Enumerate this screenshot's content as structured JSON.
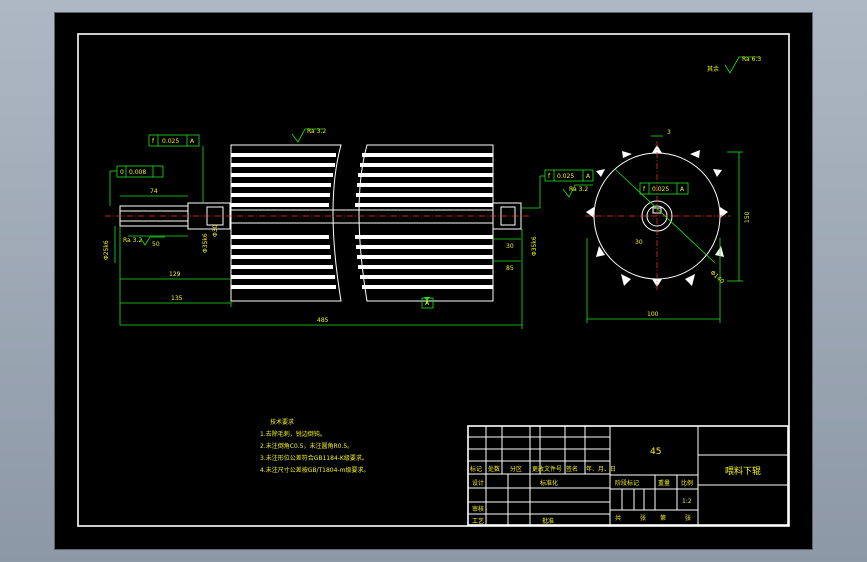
{
  "roughness_note": {
    "prefix": "其余",
    "value": "Ra 6.3"
  },
  "side_view": {
    "tolerance_labels": [
      "f",
      "0.025",
      "A"
    ],
    "tolerance_circ": [
      "f",
      "0.025",
      "A"
    ],
    "roughness": "Ra 3.2",
    "dim_top": "3",
    "dim_diam_large": "Φ140",
    "dim_small": "30",
    "dim_height": "150",
    "dim_width": "100"
  },
  "main_view": {
    "roughness_top": "Ra 3.2",
    "roughness_left": "Ra 3.2",
    "roughness_right": "Ra 3.2",
    "tol_left_top": [
      "f",
      "0.025",
      "A"
    ],
    "tol_left_mid": [
      "0",
      "0.008",
      ""
    ],
    "tol_right": [
      "f",
      "0.025",
      "A"
    ],
    "dim_74": "74",
    "dim_50": "50",
    "dim_129": "129",
    "dim_135": "135",
    "dim_485": "485",
    "dim_30": "30",
    "dim_85": "85",
    "datum": "A",
    "fit_left": "Φ25k6",
    "fit_shoulder": "Φ30",
    "fit_bearing": "Φ35k6",
    "fit_right": "Φ35k6"
  },
  "tech_requirements": {
    "title": "技术要求",
    "items": [
      "1.去除毛刺，锐边倒钝。",
      "2.未注倒角C0.5，未注圆角R0.5。",
      "3.未注形位公差符合GB1184-K级要求。",
      "4.未注尺寸公差按GB/T1804-m级要求。"
    ]
  },
  "title_block": {
    "material": "45",
    "part_name": "喂料下辊",
    "row_headers": [
      "标记",
      "处数",
      "分区",
      "更改文件号",
      "签名",
      "年、月、日"
    ],
    "designer_label": "设计",
    "standardization_label": "标准化",
    "review_label": "审核",
    "process_label": "工艺",
    "approval_label": "批准",
    "stage_label": "阶段标记",
    "weight_label": "重量",
    "scale_label": "比例",
    "scale_value": "1:2",
    "sheet_label_total": "共",
    "sheet_label_page": "张",
    "sheet_label_of": "第",
    "sheet_label_page2": "张"
  }
}
